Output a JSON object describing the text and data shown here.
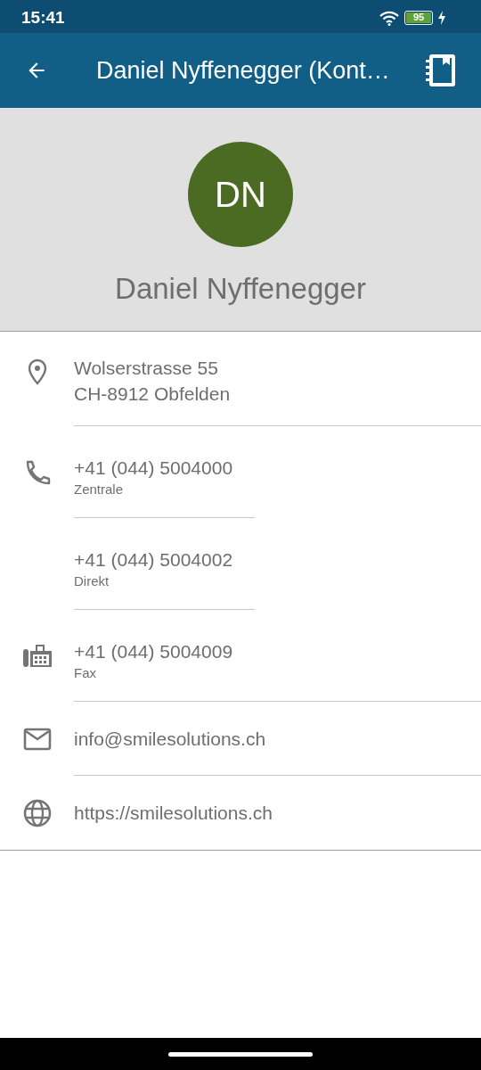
{
  "status_bar": {
    "time": "15:41",
    "battery": "95"
  },
  "app_bar": {
    "title": "Daniel Nyffenegger (Kont…"
  },
  "profile": {
    "initials": "DN",
    "name": "Daniel Nyffenegger"
  },
  "sections": [
    {
      "kind": "address",
      "items": [
        {
          "text": "Wolserstrasse 55\nCH-8912 Obfelden"
        }
      ]
    },
    {
      "kind": "phone",
      "items": [
        {
          "text": "+41 (044) 5004000",
          "label": "Zentrale"
        },
        {
          "text": "+41 (044) 5004002",
          "label": "Direkt"
        }
      ]
    },
    {
      "kind": "fax",
      "items": [
        {
          "text": "+41 (044) 5004009",
          "label": "Fax"
        }
      ]
    },
    {
      "kind": "email",
      "items": [
        {
          "text": "info@smilesolutions.ch"
        }
      ]
    },
    {
      "kind": "web",
      "items": [
        {
          "text": "https://smilesolutions.ch"
        }
      ]
    }
  ]
}
